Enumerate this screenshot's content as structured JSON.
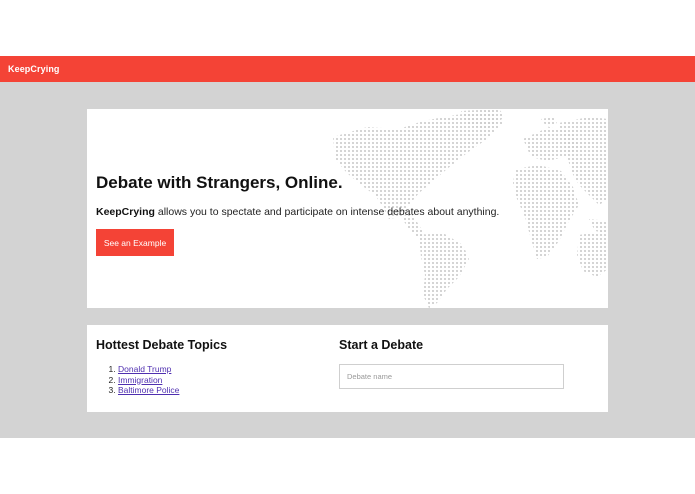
{
  "navbar": {
    "brand": "KeepCrying"
  },
  "hero": {
    "title": "Debate with Strangers, Online.",
    "text_brand": "KeepCrying",
    "text_rest": " allows you to spectate and participate on intense debates about anything.",
    "cta_label": "See an Example"
  },
  "hottest": {
    "heading": "Hottest Debate Topics",
    "topics": [
      "Donald Trump",
      "Immigration",
      "Baltimore Police"
    ]
  },
  "start": {
    "heading": "Start a Debate",
    "input_placeholder": "Debate name"
  },
  "colors": {
    "accent": "#f44336",
    "background": "#d3d3d3",
    "link": "#4f2fb0"
  },
  "icons": {
    "hero_background": "world-map-dots"
  }
}
